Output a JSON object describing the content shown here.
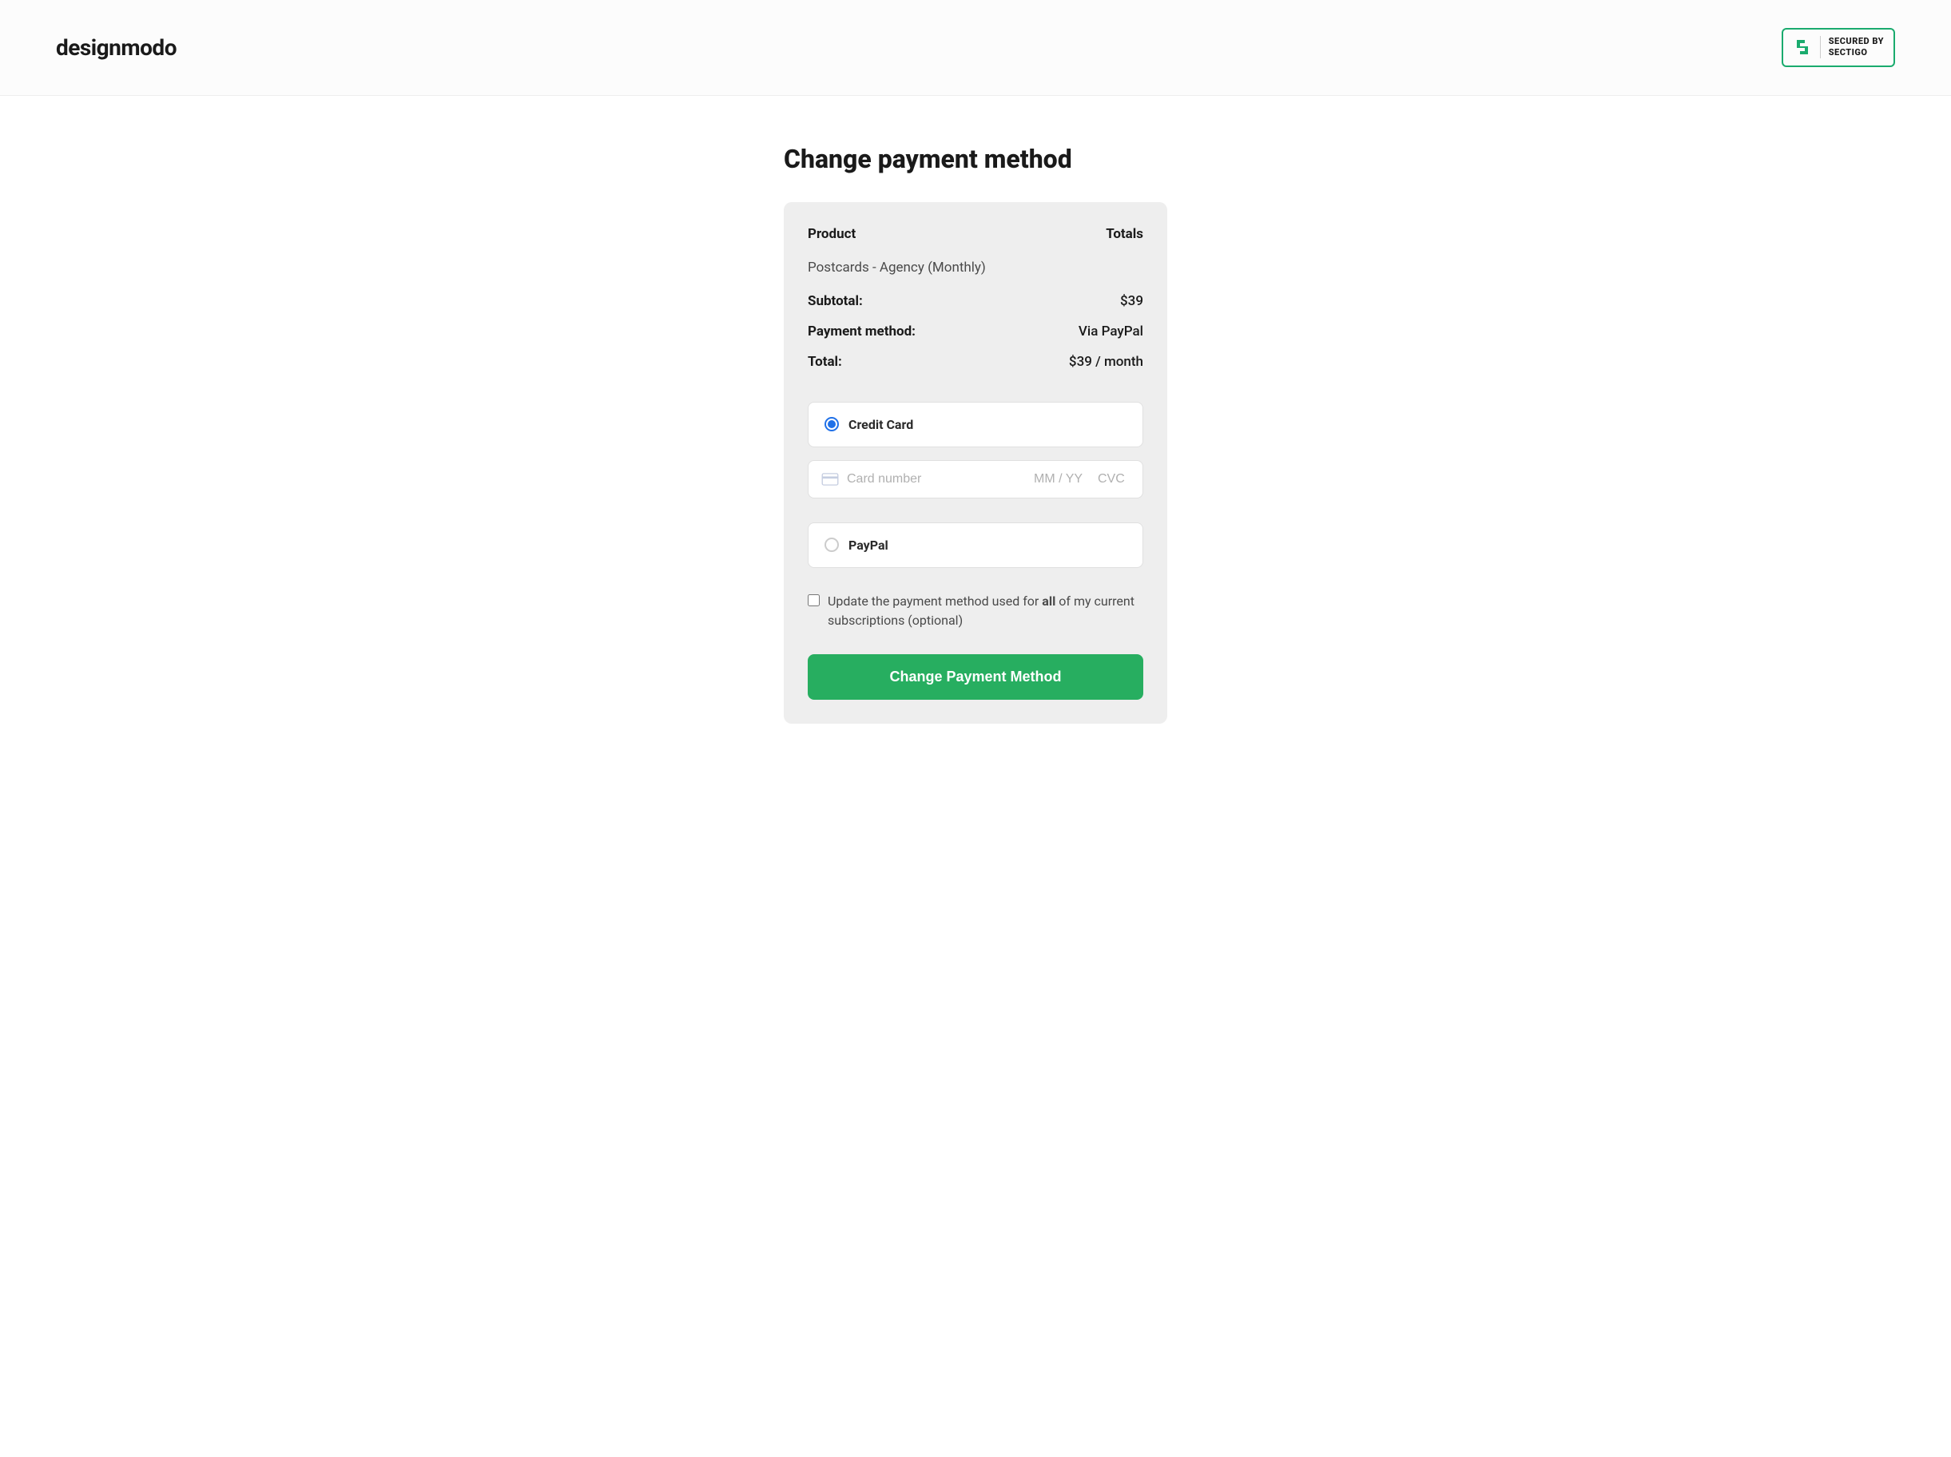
{
  "header": {
    "logo_text": "designmodo",
    "badge_line1": "SECURED BY",
    "badge_line2": "SECTIGO"
  },
  "page": {
    "title": "Change payment method"
  },
  "summary": {
    "product_header": "Product",
    "totals_header": "Totals",
    "product_name": "Postcards - Agency (Monthly)",
    "subtotal_label": "Subtotal:",
    "subtotal_value": "$39",
    "payment_method_label": "Payment method:",
    "payment_method_value": "Via PayPal",
    "total_label": "Total:",
    "total_value": "$39 / month"
  },
  "payment": {
    "credit_card_label": "Credit Card",
    "card_number_placeholder": "Card number",
    "expiry_placeholder": "MM / YY",
    "cvc_placeholder": "CVC",
    "paypal_label": "PayPal"
  },
  "checkbox": {
    "prefix": "Update the payment method used for ",
    "bold": "all",
    "suffix": " of my current subscriptions (optional)"
  },
  "button": {
    "submit_label": "Change Payment Method"
  }
}
